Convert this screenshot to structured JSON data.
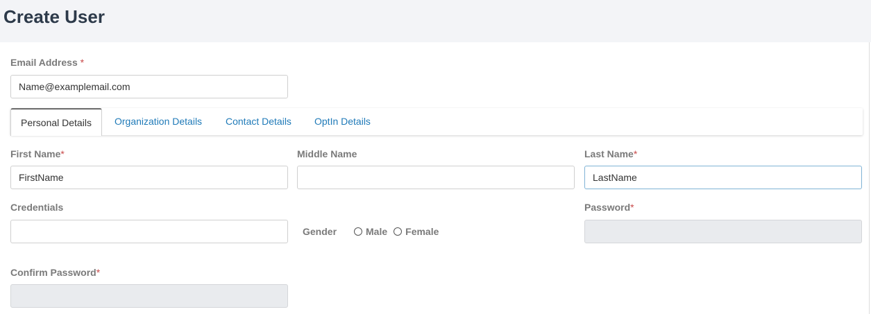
{
  "page": {
    "title": "Create User"
  },
  "email": {
    "label": "Email Address",
    "required_mark": "*",
    "value": "Name@examplemail.com"
  },
  "tabs": [
    {
      "label": "Personal Details",
      "active": true
    },
    {
      "label": "Organization Details",
      "active": false
    },
    {
      "label": "Contact Details",
      "active": false
    },
    {
      "label": "OptIn Details",
      "active": false
    }
  ],
  "fields": {
    "first_name": {
      "label": "First Name",
      "required_mark": "*",
      "value": "FirstName"
    },
    "middle_name": {
      "label": "Middle Name",
      "value": ""
    },
    "last_name": {
      "label": "Last Name",
      "required_mark": "*",
      "value": "LastName"
    },
    "credentials": {
      "label": "Credentials",
      "value": ""
    },
    "password": {
      "label": "Password",
      "required_mark": "*",
      "value": ""
    },
    "confirm_password": {
      "label": "Confirm Password",
      "required_mark": "*",
      "value": ""
    },
    "gender": {
      "label": "Gender",
      "options": [
        "Male",
        "Female"
      ]
    }
  },
  "colors": {
    "header_bg": "#f3f4f7",
    "title": "#2d3a4a",
    "label": "#7a7a7a",
    "required": "#c84a4a",
    "tab_link": "#1f7ab8",
    "disabled_bg": "#e9ebee"
  }
}
